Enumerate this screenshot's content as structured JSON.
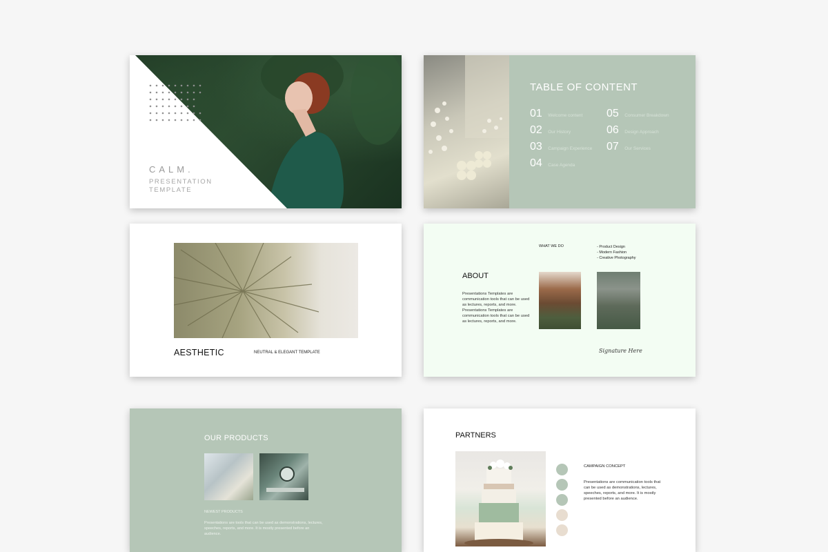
{
  "colors": {
    "sage": "#b5c6b7",
    "mint": "#f3fdf3",
    "page": "#f6f6f6",
    "sand": "#e8ddd0"
  },
  "slide1": {
    "title": "CALM.",
    "subtitle_line1": "PRESENTATION",
    "subtitle_line2": "TEMPLATE"
  },
  "slide2": {
    "title": "TABLE OF CONTENT",
    "items": [
      {
        "num": "01",
        "label": "Welcome content"
      },
      {
        "num": "02",
        "label": "Our History"
      },
      {
        "num": "03",
        "label": "Campaign Experience"
      },
      {
        "num": "04",
        "label": "Case Agenda"
      },
      {
        "num": "05",
        "label": "Consumer Breakdown"
      },
      {
        "num": "06",
        "label": "Design Approach"
      },
      {
        "num": "07",
        "label": "Our Services"
      }
    ]
  },
  "slide3": {
    "title": "AESTHETIC",
    "subtitle": "NEUTRAL & ELEGANT TEMPLATE"
  },
  "slide4": {
    "what_we_do": "WHAT WE DO",
    "services": [
      "- Product Design",
      "- Modern Fashion",
      "- Creative Photography"
    ],
    "title": "ABOUT",
    "paragraph": "Presentations Templates are communication tools that can be used as lectures, reports, and more. Presentations Templates are communication tools that can be used as lectures, reports, and more.",
    "signature": "Signature Here"
  },
  "slide5": {
    "title": "OUR PRODUCTS",
    "caption": "NEWEST PRODUCTS",
    "paragraph": "Presentations are tools that can be used as demonstrations, lectures, speeches, reports, and more. It is mostly presented before an audience."
  },
  "slide6": {
    "title": "PARTNERS",
    "subtitle": "CAMPAIGN CONCEPT",
    "paragraph": "Presentations are communication tools that can be used as demonstrations, lectures, speeches, reports, and more. It is mostly presented before an audience.",
    "swatches": [
      "#b5c6b7",
      "#b5c6b7",
      "#b5c6b7",
      "#e8ddd0",
      "#e8ddd0"
    ]
  }
}
